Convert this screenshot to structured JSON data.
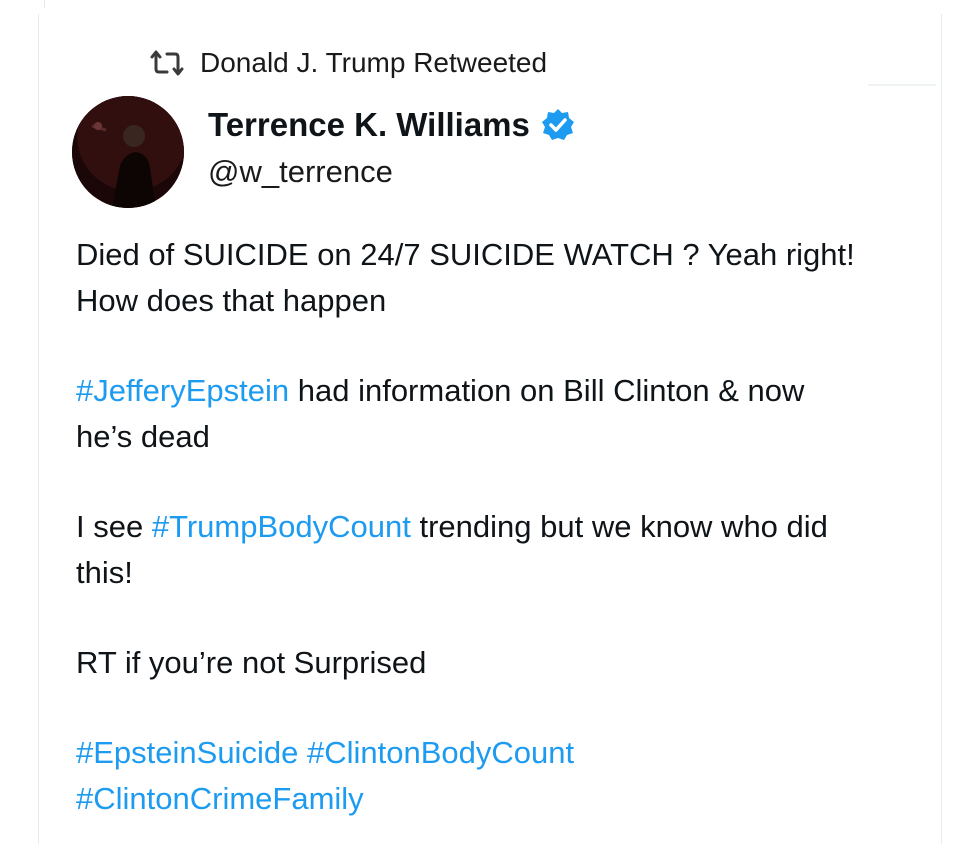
{
  "retweet": {
    "label": "Donald J. Trump Retweeted",
    "icon": "retweet-icon"
  },
  "author": {
    "name": "Terrence K. Williams",
    "handle": "@w_terrence",
    "verified": true,
    "verified_color": "#1d9bf0"
  },
  "tweet": {
    "p1_line1": "Died of SUICIDE on 24/7 SUICIDE WATCH ? Yeah right!",
    "p1_line2": "How does that happen",
    "p2_tag": "#JefferyEpstein",
    "p2_text_line1": " had information on Bill Clinton & now",
    "p2_text_line2": "he’s dead",
    "p3_pre": "I see ",
    "p3_tag": "#TrumpBodyCount",
    "p3_text_line1": " trending but we know who did",
    "p3_text_line2": "this!",
    "p4": "RT if you’re not Surprised",
    "tags": [
      "#EpsteinSuicide",
      "#ClintonBodyCount",
      "#ClintonCrimeFamily"
    ]
  },
  "colors": {
    "link": "#1d9bf0",
    "text": "#0f1419",
    "secondary": "#536471"
  }
}
